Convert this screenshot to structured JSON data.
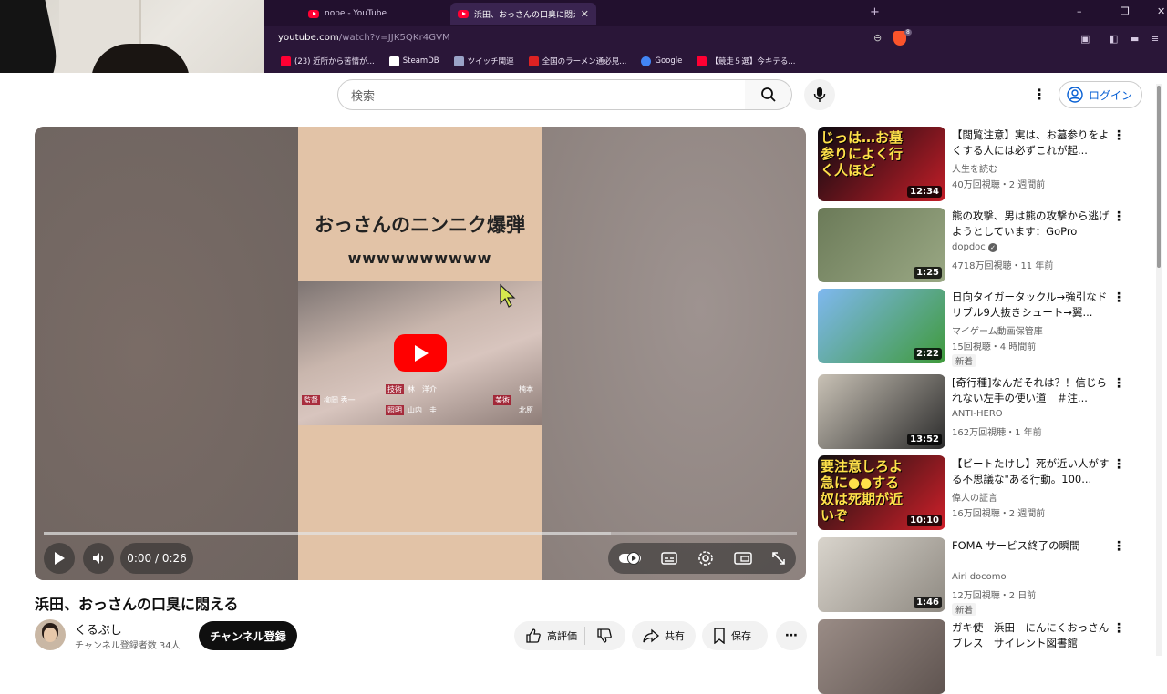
{
  "browser": {
    "tabs": [
      {
        "title": "nope - YouTube"
      },
      {
        "title": "浜田、おっさんの口臭に悶える - You"
      }
    ],
    "url_host": "youtube.com",
    "url_path": "/watch?v=JJK5QKr4GVM",
    "bookmarks": [
      {
        "label": "(23) 近所から苦情が...",
        "color": "#f03"
      },
      {
        "label": "SteamDB",
        "color": "#ffffff"
      },
      {
        "label": "ツイッチ関連",
        "color": "#9aa3c7"
      },
      {
        "label": "全国のラーメン通必見...",
        "color": "#d22"
      },
      {
        "label": "Google",
        "color": "#4285f4"
      },
      {
        "label": "【競走５選】今キテる...",
        "color": "#f03"
      }
    ],
    "extension_badge": "8"
  },
  "youtube": {
    "search_placeholder": "検索",
    "login_label": "ログイン"
  },
  "player": {
    "video_text_main": "おっさんのニンニク爆弾",
    "video_text_sub": "wwwwwwwwww",
    "credits": [
      "監督",
      "柳岡 秀一",
      "技術",
      "林　洋介",
      "美術",
      "楠本",
      "照明",
      "山内　圭",
      "北原"
    ],
    "time": "0:00 / 0:26",
    "progress_fraction": 0.753
  },
  "video": {
    "title": "浜田、おっさんの口臭に悶える",
    "channel": "くるぶし",
    "subscribers": "チャンネル登録者数 34人",
    "subscribe_label": "チャンネル登録",
    "actions": {
      "like": "高評価",
      "share": "共有",
      "save": "保存"
    }
  },
  "related": [
    {
      "title": "【閲覧注意】実は、お墓参りをよくする人には必ずこれが起...",
      "channel": "人生を読む",
      "meta": "40万回視聴・2 週間前",
      "duration": "12:34",
      "thumb_text": "じっは…お墓参りによく行く人ほど",
      "colors": [
        "#0a0a10",
        "#c41e28"
      ]
    },
    {
      "title": "熊の攻撃、男は熊の攻撃から逃げようとしています：GoPro",
      "channel": "dopdoc",
      "meta": "4718万回視聴・11 年前",
      "duration": "1:25",
      "verified": true,
      "colors": [
        "#6b7a58",
        "#9aa884"
      ]
    },
    {
      "title": "日向タイガータックル→強引なドリブル9人抜きシュート→翼...",
      "channel": "マイゲーム動画保管庫",
      "meta": "15回視聴・4 時間前",
      "duration": "2:22",
      "badge": "新着",
      "colors": [
        "#7fb8f0",
        "#3f9a3a"
      ]
    },
    {
      "title": "[奇行種]なんだそれは？！信じられない左手の使い道　＃注...",
      "channel": "ANTI-HERO",
      "meta": "162万回視聴・1 年前",
      "duration": "13:52",
      "colors": [
        "#c9c2b6",
        "#2b2b2b"
      ]
    },
    {
      "title": "【ビートたけし】死が近い人がする不思議な\"ある行動。100...",
      "channel": "偉人の証言",
      "meta": "16万回視聴・2 週間前",
      "duration": "10:10",
      "thumb_text": "要注意しろよ急に●●する奴は死期が近いぞ",
      "colors": [
        "#101010",
        "#d0202a"
      ]
    },
    {
      "title": "FOMA サービス終了の瞬間",
      "channel": "Airi docomo",
      "meta": "12万回視聴・2 日前",
      "duration": "1:46",
      "badge": "新着",
      "colors": [
        "#d9d4cc",
        "#8f8a82"
      ]
    },
    {
      "title": "ガキ使　浜田　にんにくおっさんブレス　サイレント図書館",
      "channel": "",
      "meta": "",
      "duration": "",
      "colors": [
        "#9a8c86",
        "#5f5450"
      ]
    }
  ]
}
